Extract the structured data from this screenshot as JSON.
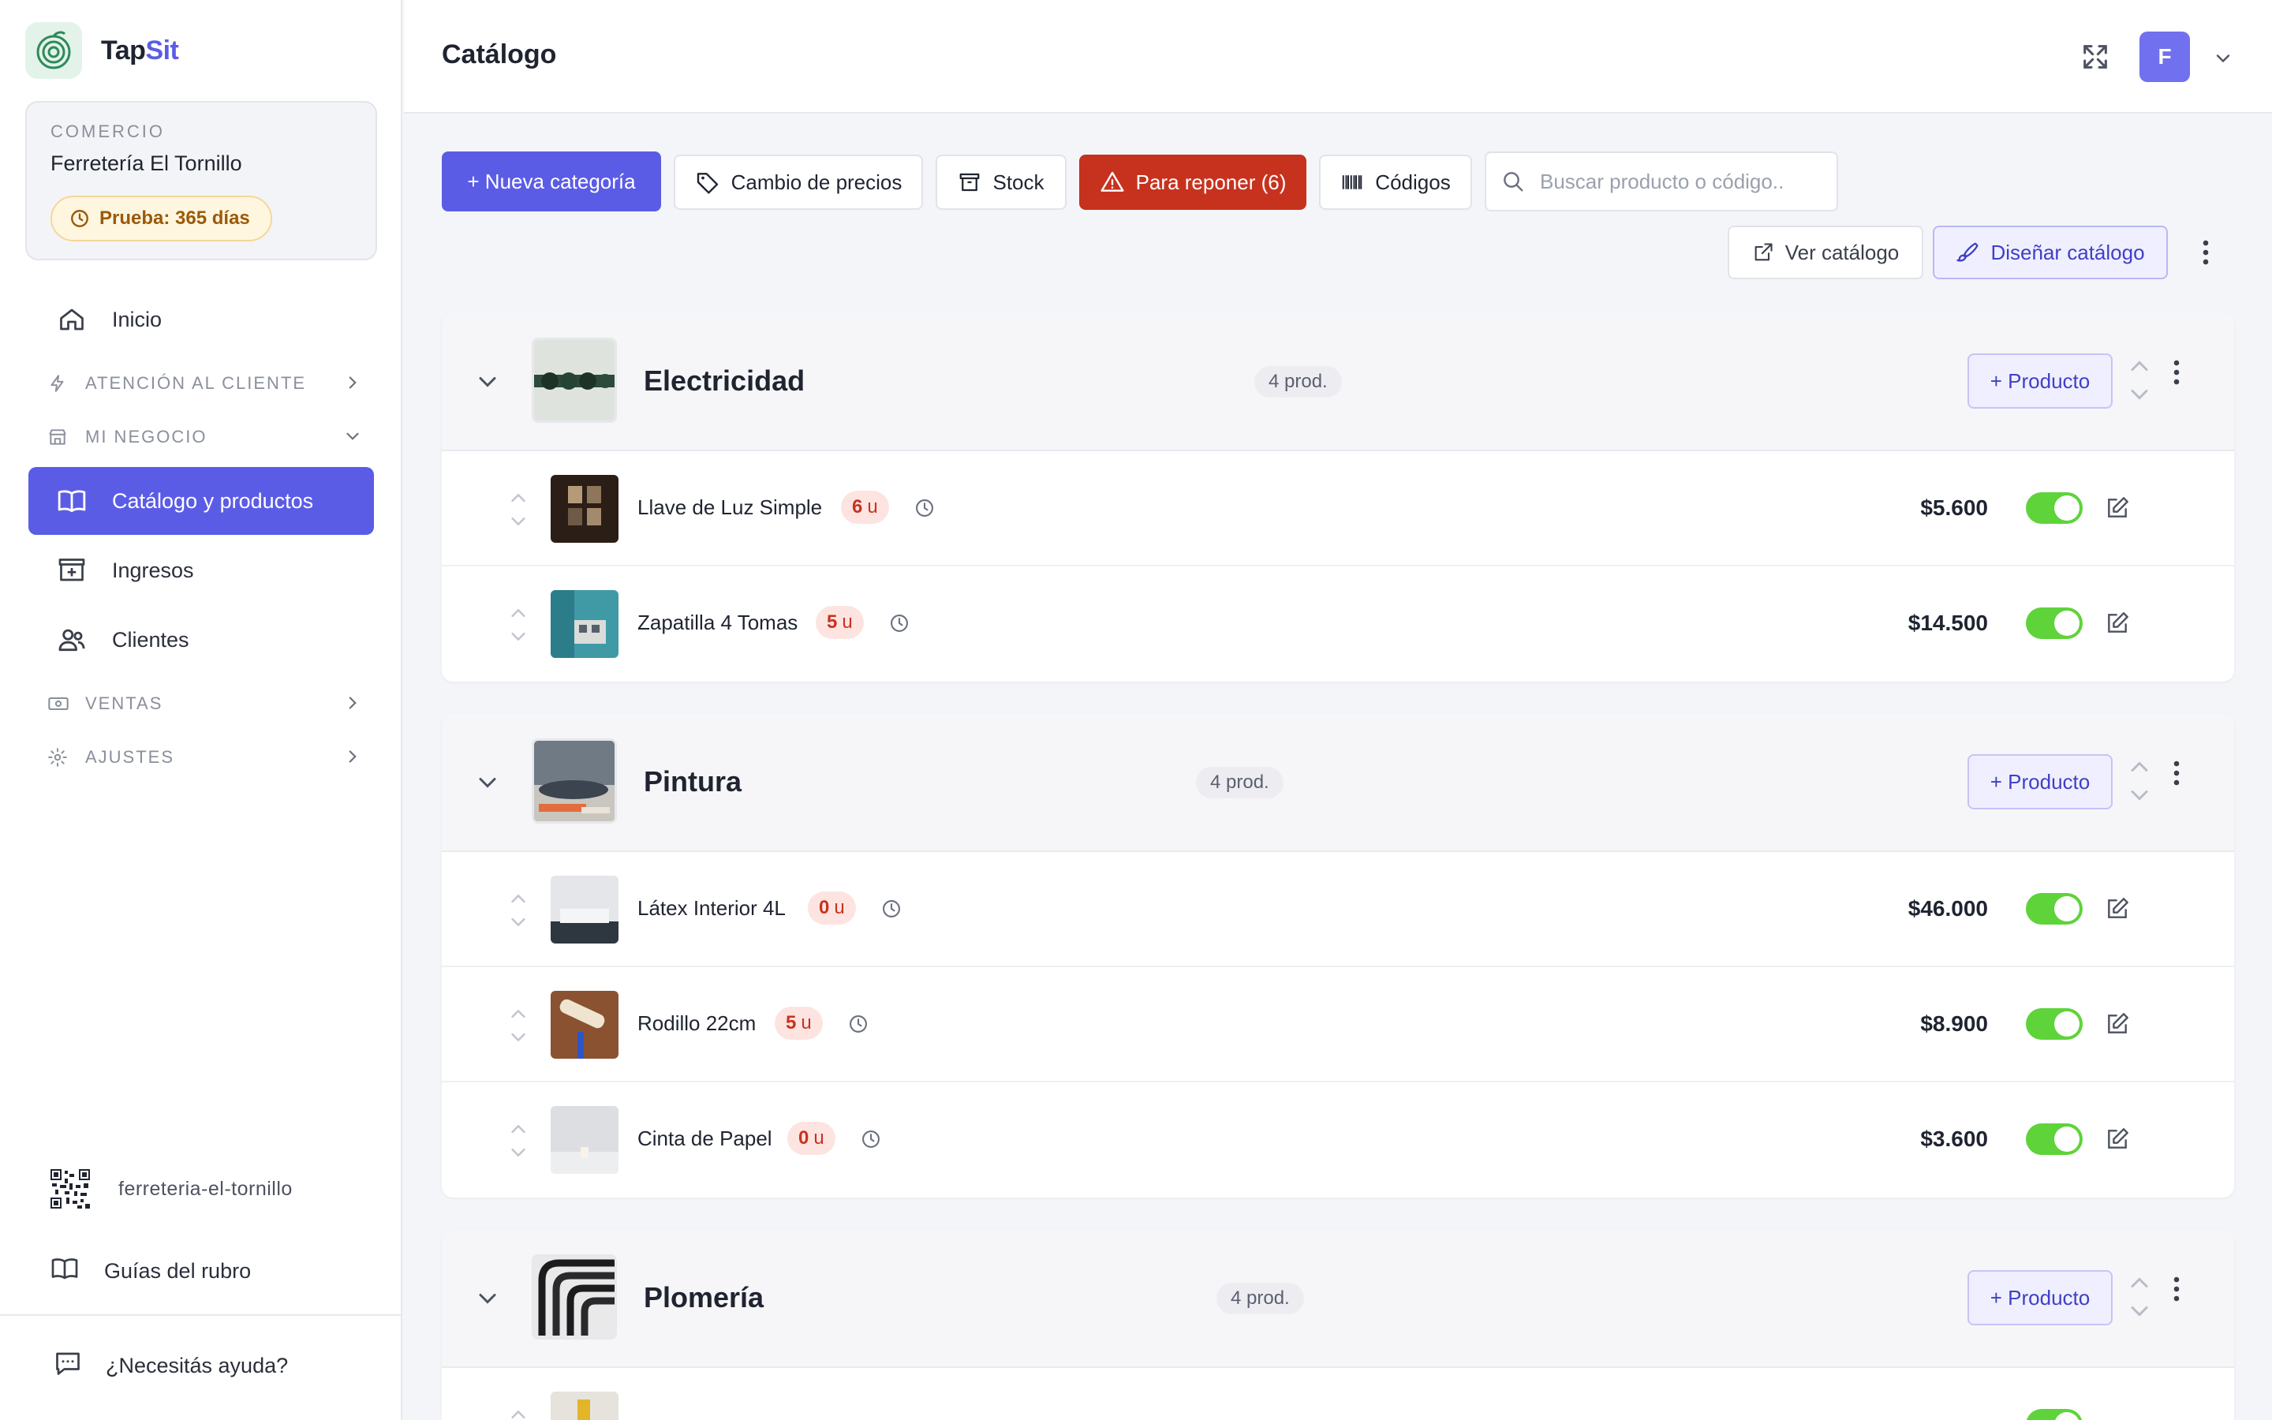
{
  "brand": {
    "name_a": "Tap",
    "name_b": "Sit"
  },
  "business": {
    "label": "COMERCIO",
    "name": "Ferretería El Tornillo",
    "trial": "Prueba: 365 días"
  },
  "sidebar": {
    "home": "Inicio",
    "section_customer": "ATENCIÓN AL CLIENTE",
    "section_business": "MI NEGOCIO",
    "catalog": "Catálogo y productos",
    "income": "Ingresos",
    "clients": "Clientes",
    "section_sales": "VENTAS",
    "section_settings": "AJUSTES",
    "slug": "ferreteria-el-tornillo",
    "guides": "Guías del rubro",
    "help": "¿Necesitás ayuda?"
  },
  "header": {
    "title": "Catálogo",
    "avatar_initial": "F"
  },
  "toolbar": {
    "new_category": "+ Nueva categoría",
    "price_change": "Cambio de precios",
    "stock": "Stock",
    "restock": "Para reponer (6)",
    "codes": "Códigos",
    "search_placeholder": "Buscar producto o código..",
    "view_catalog": "Ver catálogo",
    "design_catalog": "Diseñar catálogo"
  },
  "categories": [
    {
      "name": "Electricidad",
      "count": "4 prod.",
      "add_label": "+ Producto",
      "products": [
        {
          "name": "Llave de Luz Simple",
          "stock": "6",
          "unit": "u",
          "price": "$5.600",
          "active": true
        },
        {
          "name": "Zapatilla 4 Tomas",
          "stock": "5",
          "unit": "u",
          "price": "$14.500",
          "active": true
        }
      ]
    },
    {
      "name": "Pintura",
      "count": "4 prod.",
      "add_label": "+ Producto",
      "products": [
        {
          "name": "Látex Interior 4L",
          "stock": "0",
          "unit": "u",
          "price": "$46.000",
          "active": true
        },
        {
          "name": "Rodillo 22cm",
          "stock": "5",
          "unit": "u",
          "price": "$8.900",
          "active": true
        },
        {
          "name": "Cinta de Papel",
          "stock": "0",
          "unit": "u",
          "price": "$3.600",
          "active": true
        }
      ]
    },
    {
      "name": "Plomería",
      "count": "4 prod.",
      "add_label": "+ Producto",
      "products": []
    }
  ],
  "colors": {
    "accent": "#5b5ce6",
    "danger": "#c7321f",
    "toggle_on": "#5fd33a",
    "badge_bg": "#fde4e1"
  }
}
